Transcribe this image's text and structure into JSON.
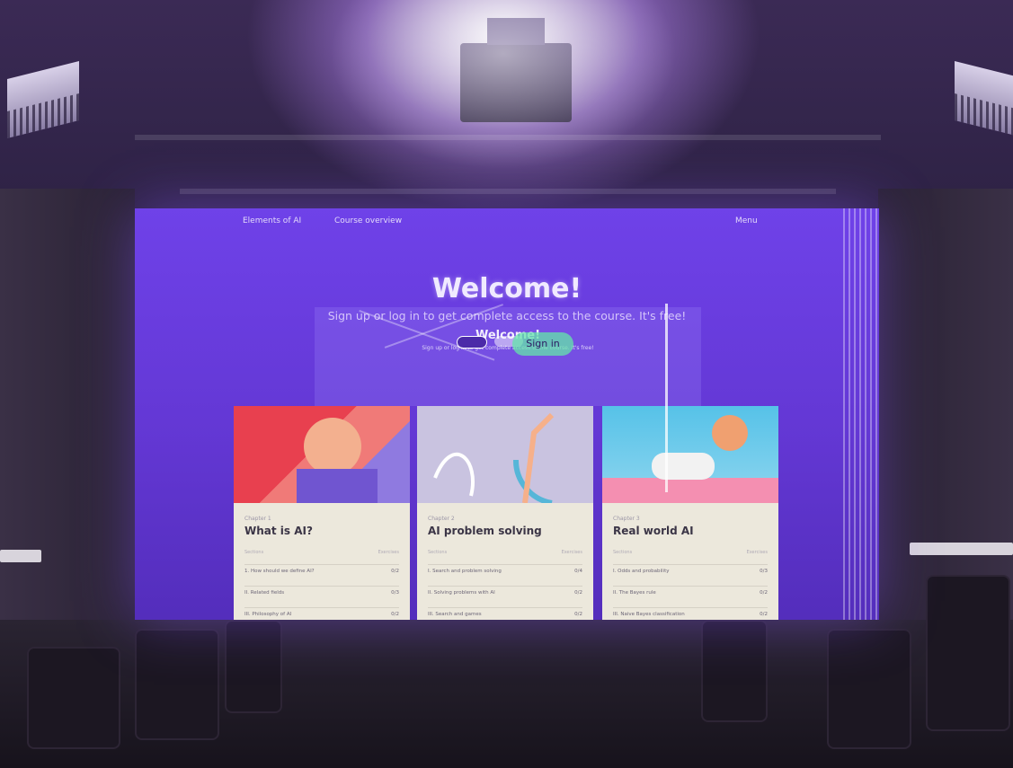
{
  "screen": {
    "nav": {
      "brand": "Elements of AI",
      "course": "Course overview",
      "lang": "Menu"
    },
    "welcome": "Welcome!",
    "subtitle": "Sign up or log in to get complete access to the course. It's free!",
    "ghost_title": "Welcome!",
    "ghost_subtitle": "Sign up or log in to get complete access to the course. It's free!",
    "button_green": "Sign in",
    "button_a": "",
    "button_b": ""
  },
  "cards": [
    {
      "chapter": "Chapter 1",
      "title": "What is AI?",
      "col_left": "Sections",
      "col_right": "Exercises",
      "rows": [
        {
          "label": "1. How should we define AI?",
          "value": "0/2"
        },
        {
          "label": "II. Related fields",
          "value": "0/3"
        },
        {
          "label": "III. Philosophy of AI",
          "value": "0/2"
        }
      ]
    },
    {
      "chapter": "Chapter 2",
      "title": "AI problem solving",
      "col_left": "Sections",
      "col_right": "Exercises",
      "rows": [
        {
          "label": "I. Search and problem solving",
          "value": "0/4"
        },
        {
          "label": "II. Solving problems with AI",
          "value": "0/2"
        },
        {
          "label": "III. Search and games",
          "value": "0/2"
        }
      ]
    },
    {
      "chapter": "Chapter 3",
      "title": "Real world AI",
      "col_left": "Sections",
      "col_right": "Exercises",
      "rows": [
        {
          "label": "I. Odds and probability",
          "value": "0/3"
        },
        {
          "label": "II. The Bayes rule",
          "value": "0/2"
        },
        {
          "label": "III. Naive Bayes classification",
          "value": "0/2"
        }
      ]
    }
  ],
  "colors": {
    "projection": "#7a46ff",
    "card_body": "#ece8dc",
    "card1": "#e8404f",
    "card2": "#c9c3e0",
    "card3": "#56c2e8"
  }
}
